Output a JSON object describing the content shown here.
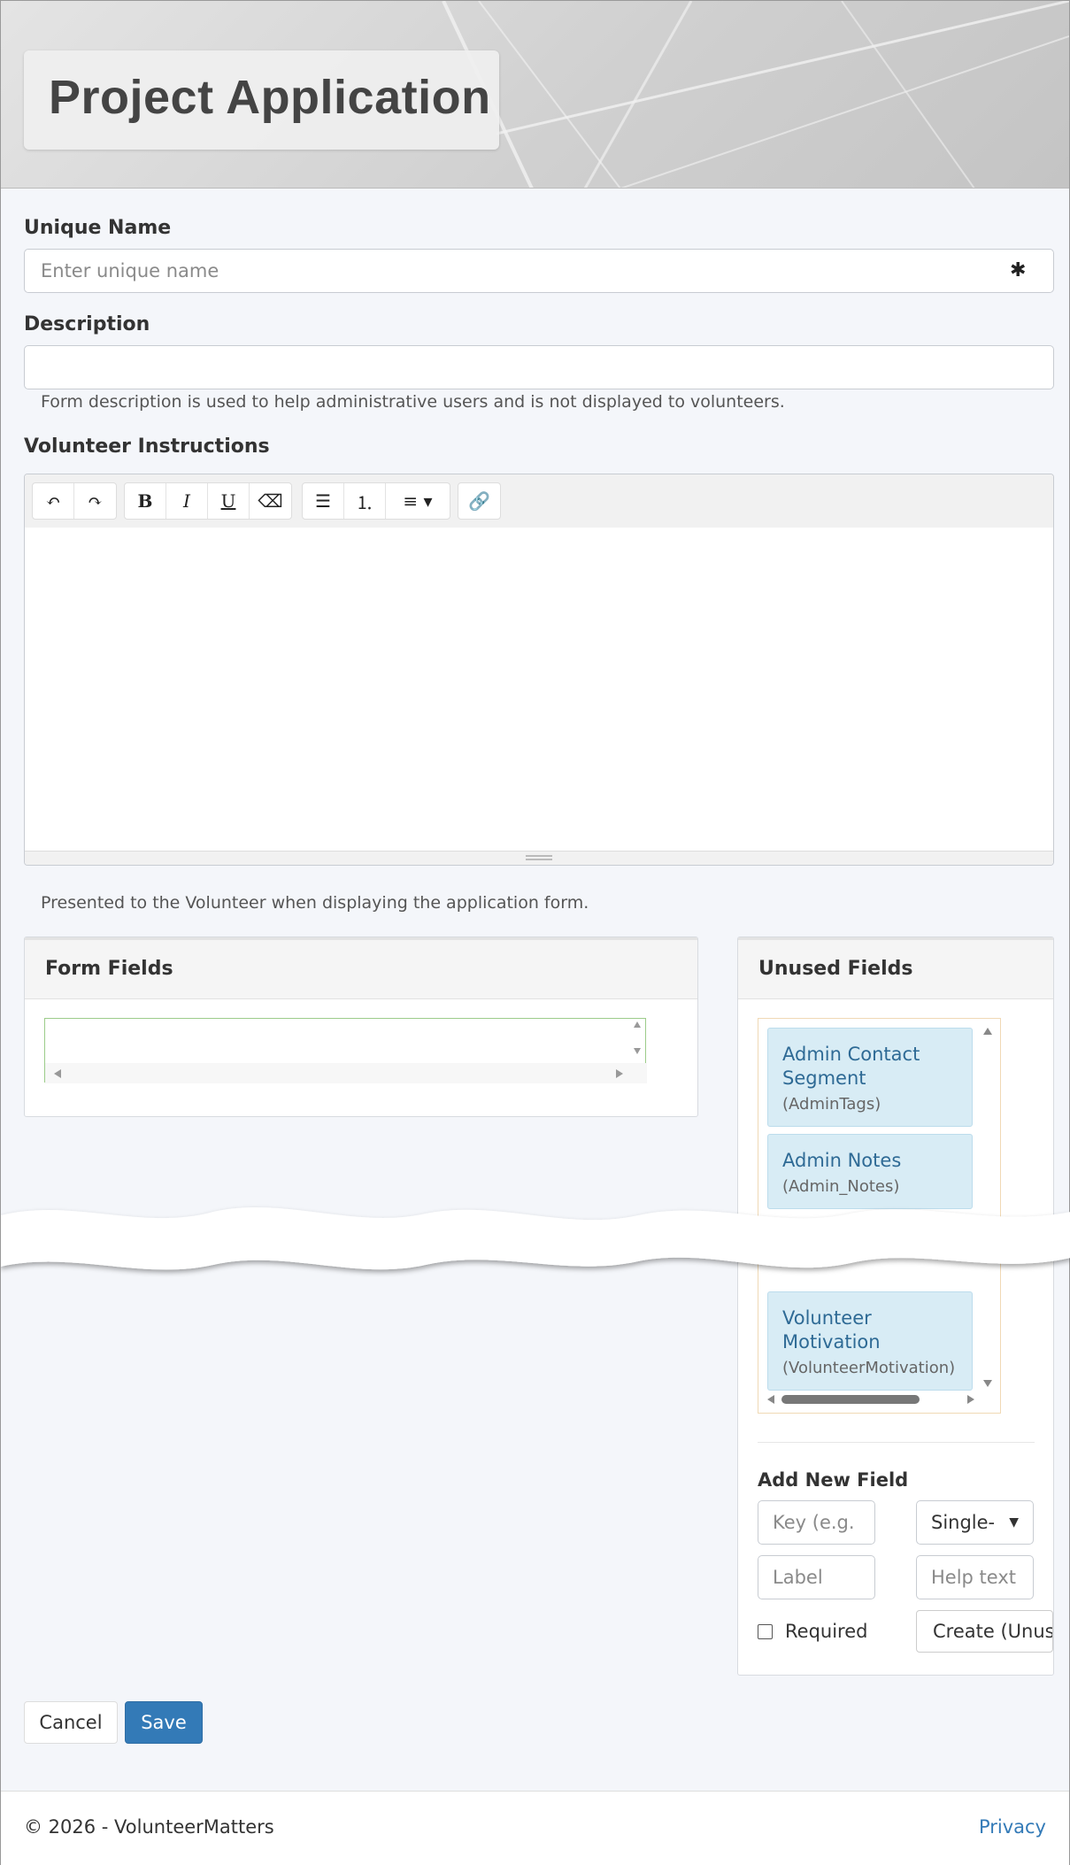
{
  "page": {
    "title": "Project Application"
  },
  "form": {
    "unique_name": {
      "label": "Unique Name",
      "placeholder": "Enter unique name",
      "required_mark": "✱"
    },
    "description": {
      "label": "Description",
      "value": "",
      "help": "Form description is used to help administrative users and is not displayed to volunteers."
    },
    "instructions": {
      "label": "Volunteer Instructions",
      "help": "Presented to the Volunteer when displaying the application form."
    }
  },
  "toolbar": {
    "undo": "↶",
    "redo": "↷",
    "bold": "B",
    "italic": "I",
    "underline": "U",
    "eraser": "⌫",
    "bullets": "☰",
    "numbers": "⒈",
    "align": "≡ ▾",
    "link": "🔗"
  },
  "form_fields": {
    "title": "Form Fields"
  },
  "unused_fields": {
    "title": "Unused Fields",
    "items": [
      {
        "label": "Admin Contact Segment",
        "key": "(AdminTags)"
      },
      {
        "label": "Admin Notes",
        "key": "(Admin_Notes)"
      },
      {
        "label": "Volunteer Motivation",
        "key": "(VolunteerMotivation)"
      }
    ]
  },
  "add_field": {
    "title": "Add New Field",
    "key_placeholder": "Key (e.g.",
    "type_selected": "Single-",
    "label_placeholder": "Label",
    "help_placeholder": "Help text",
    "required_label": "Required",
    "create_label": "Create (Unused)"
  },
  "actions": {
    "cancel": "Cancel",
    "save": "Save"
  },
  "footer": {
    "copyright": "© 2026 - VolunteerMatters",
    "privacy": "Privacy"
  },
  "colors": {
    "primary": "#337ab7",
    "link": "#337ab7"
  }
}
